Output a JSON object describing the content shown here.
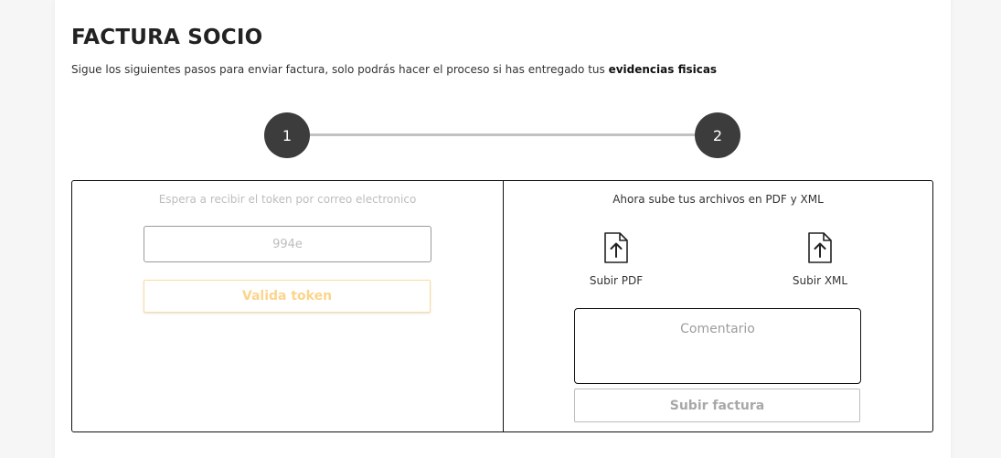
{
  "header": {
    "title": "FACTURA SOCIO",
    "subtitle_text": "Sigue los siguientes pasos para enviar factura, solo podrás hacer el proceso si has entregado tus ",
    "subtitle_bold": "evidencias fisicas"
  },
  "stepper": {
    "steps": [
      "1",
      "2"
    ]
  },
  "step1": {
    "hint": "Espera a recibir el token por correo electronico",
    "token_value": "994e",
    "validate_label": "Valida token"
  },
  "step2": {
    "hint": "Ahora sube tus archivos en PDF y XML",
    "upload_pdf_label": "Subir PDF",
    "upload_xml_label": "Subir XML",
    "upload_icon": "file-upload-icon",
    "comment_placeholder": "Comentario",
    "submit_label": "Subir factura"
  },
  "colors": {
    "step_circle": "#3c3c3c",
    "validate_text": "#fcd48c",
    "validate_border": "#fbdc9a"
  }
}
